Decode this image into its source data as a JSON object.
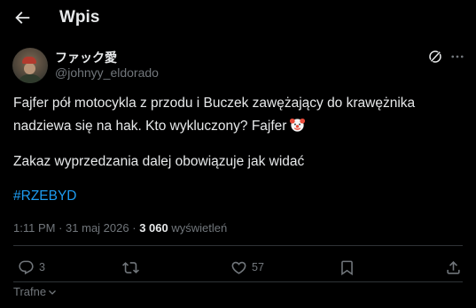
{
  "header": {
    "title": "Wpis",
    "back_icon": "arrow-left-icon"
  },
  "author": {
    "display_name": "ファック愛",
    "handle": "@johnyy_eldorado"
  },
  "tweet": {
    "line1": "Fajfer pół motocykla z przodu i Buczek zawężający do krawężnika",
    "line2": "nadziewa się na hak. Kto wykluczony? Fajfer",
    "emoji": "clown-face",
    "line3": "Zakaz wyprzedzania dalej obowiązuje jak widać",
    "hashtag": "#RZEBYD"
  },
  "meta": {
    "time": "1:11 PM",
    "separator": "·",
    "date": "31 maj 2026",
    "views_count": "3 060",
    "views_label": "wyświetleń"
  },
  "actions": {
    "reply_count": "3",
    "like_count": "57"
  },
  "sort": {
    "label": "Trafne"
  },
  "colors": {
    "accent": "#1d9bf0",
    "muted": "#71767b",
    "text": "#e7e9ea",
    "divider": "#2f3336"
  }
}
